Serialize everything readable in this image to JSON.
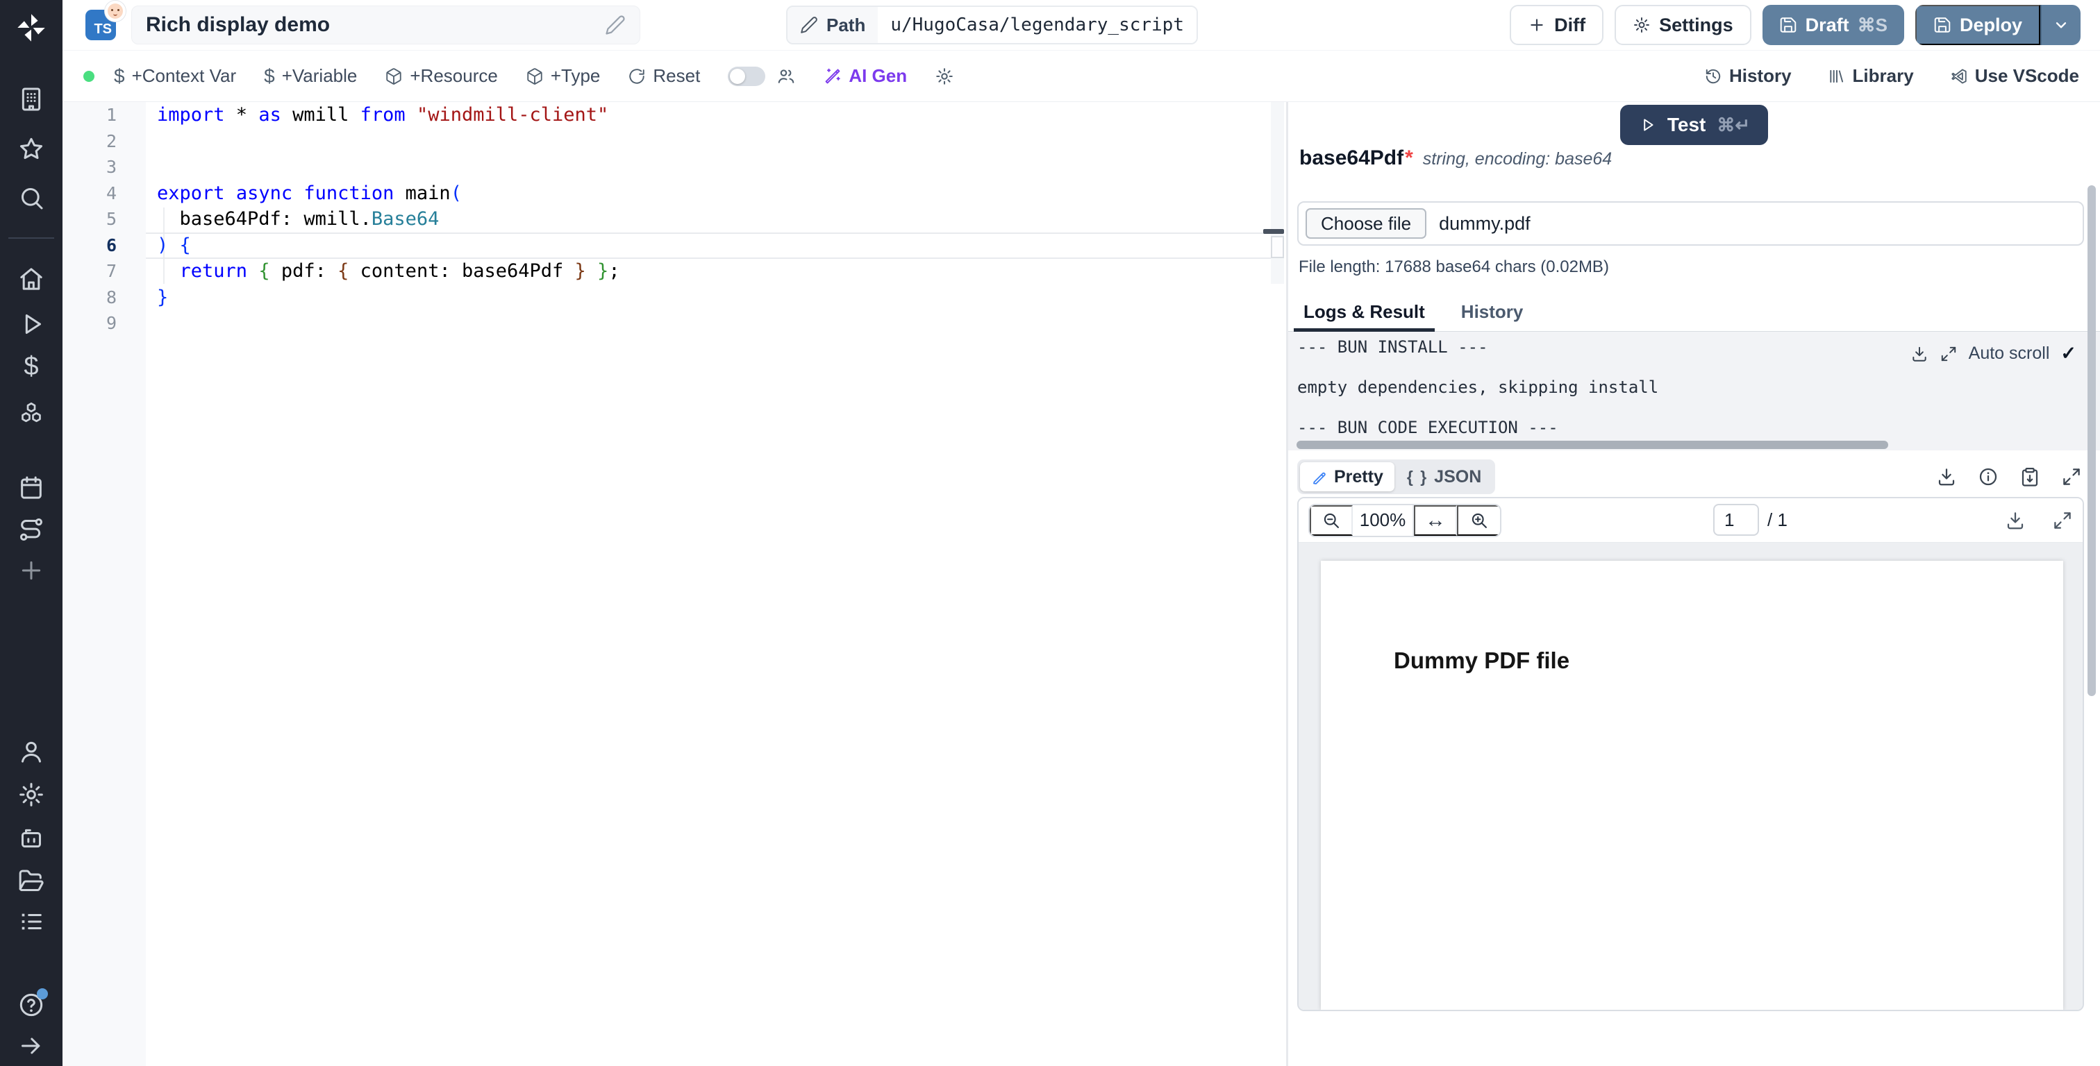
{
  "header": {
    "language_badge": "TS",
    "badge_emoji": "👶",
    "title": "Rich display demo",
    "path_label": "Path",
    "path_value": "u/HugoCasa/legendary_script",
    "diff_label": "Diff",
    "settings_label": "Settings",
    "draft_label": "Draft",
    "draft_shortcut": "⌘S",
    "deploy_label": "Deploy"
  },
  "toolbar": {
    "context_var": "+Context Var",
    "variable": "+Variable",
    "resource": "+Resource",
    "type": "+Type",
    "reset": "Reset",
    "ai_gen": "AI Gen",
    "history": "History",
    "library": "Library",
    "vscode": "Use VScode"
  },
  "icons": {
    "dollar": "$",
    "braces": "{ }",
    "check": "✓",
    "fit_width": "↔"
  },
  "editor": {
    "active_line": 6,
    "line_numbers": [
      "1",
      "2",
      "3",
      "4",
      "5",
      "6",
      "7",
      "8",
      "9"
    ],
    "lines": [
      [
        {
          "c": "kw",
          "t": "import"
        },
        {
          "c": "pl",
          "t": " * "
        },
        {
          "c": "kw",
          "t": "as"
        },
        {
          "c": "pl",
          "t": " wmill "
        },
        {
          "c": "kw",
          "t": "from"
        },
        {
          "c": "pl",
          "t": " "
        },
        {
          "c": "str",
          "t": "\"windmill-client\""
        }
      ],
      [],
      [],
      [
        {
          "c": "kw",
          "t": "export"
        },
        {
          "c": "pl",
          "t": " "
        },
        {
          "c": "kw",
          "t": "async"
        },
        {
          "c": "pl",
          "t": " "
        },
        {
          "c": "kw",
          "t": "function"
        },
        {
          "c": "pl",
          "t": " main"
        },
        {
          "c": "b1",
          "t": "("
        }
      ],
      [
        {
          "c": "pl",
          "t": "  base64Pdf: wmill."
        },
        {
          "c": "ty",
          "t": "Base64"
        }
      ],
      [
        {
          "c": "b1",
          "t": ") {"
        }
      ],
      [
        {
          "c": "pl",
          "t": "  "
        },
        {
          "c": "kw",
          "t": "return"
        },
        {
          "c": "pl",
          "t": " "
        },
        {
          "c": "b2",
          "t": "{"
        },
        {
          "c": "pl",
          "t": " pdf: "
        },
        {
          "c": "b3",
          "t": "{"
        },
        {
          "c": "pl",
          "t": " content: base64Pdf "
        },
        {
          "c": "b3",
          "t": "}"
        },
        {
          "c": "pl",
          "t": " "
        },
        {
          "c": "b2",
          "t": "}"
        },
        {
          "c": "pl",
          "t": ";"
        }
      ],
      [
        {
          "c": "b1",
          "t": "}"
        }
      ],
      []
    ]
  },
  "panel": {
    "test_label": "Test",
    "test_shortcut": "⌘↵",
    "arg_name": "base64Pdf",
    "required_mark": "*",
    "arg_meta": "string, encoding: base64",
    "choose_file_label": "Choose file",
    "file_name": "dummy.pdf",
    "file_length": "File length: 17688 base64 chars (0.02MB)",
    "tab_logs": "Logs & Result",
    "tab_history": "History",
    "logs": [
      "--- BUN INSTALL ---",
      "",
      "empty dependencies, skipping install",
      "",
      "--- BUN CODE EXECUTION ---"
    ],
    "auto_scroll_label": "Auto scroll",
    "pretty_label": "Pretty",
    "json_label": "JSON",
    "pdf": {
      "zoom_level": "100%",
      "page_value": "1",
      "page_total": "/ 1",
      "page_text": "Dummy PDF file"
    }
  },
  "colors": {
    "badge_blue": "#3178c6",
    "slate_button": "#60809f",
    "test_button_navy": "#2e3f5c",
    "ai_purple": "#7c3aed",
    "status_green": "#4ade80",
    "required_red": "#ef4444"
  }
}
